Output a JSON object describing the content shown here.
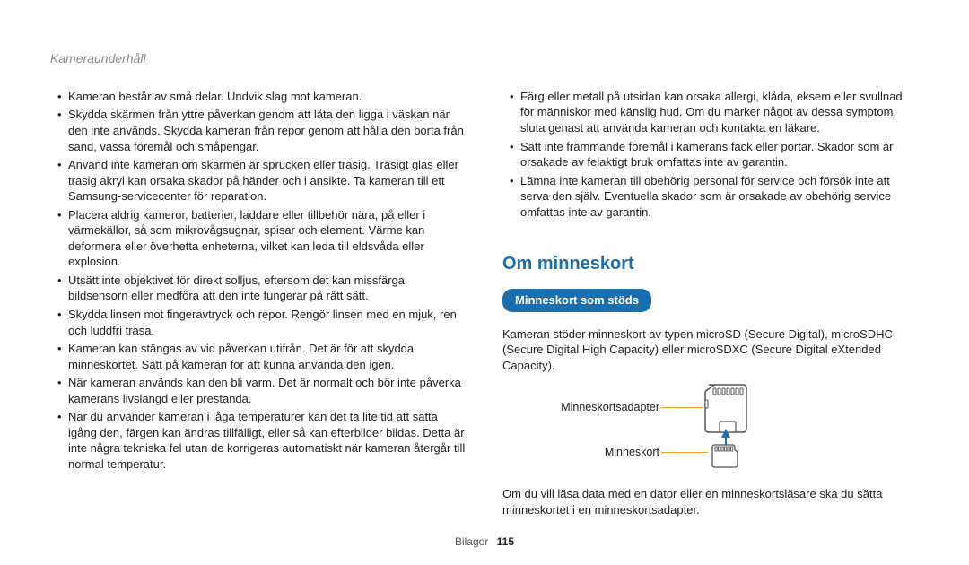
{
  "header": {
    "breadcrumb": "Kameraunderhåll"
  },
  "left": {
    "bullets": [
      "Kameran består av små delar. Undvik slag mot kameran.",
      "Skydda skärmen från yttre påverkan genom att låta den ligga i väskan när den inte används. Skydda kameran från repor genom att hålla den borta från sand, vassa föremål och småpengar.",
      "Använd inte kameran om skärmen är sprucken eller trasig. Trasigt glas eller trasig akryl kan orsaka skador på händer och i ansikte. Ta kameran till ett Samsung-servicecenter för reparation.",
      "Placera aldrig kameror, batterier, laddare eller tillbehör nära, på eller i värmekällor, så som mikrovågsugnar, spisar och element. Värme kan deformera eller överhetta enheterna, vilket kan leda till eldsvåda eller explosion.",
      "Utsätt inte objektivet för direkt solljus, eftersom det kan missfärga bildsensorn eller medföra att den inte fungerar på rätt sätt.",
      "Skydda linsen mot fingeravtryck och repor. Rengör linsen med en mjuk, ren och luddfri trasa.",
      "Kameran kan stängas av vid påverkan utifrån. Det är för att skydda minneskortet. Sätt på kameran för att kunna använda den igen.",
      "När kameran används kan den bli varm. Det är normalt och bör inte påverka kamerans livslängd eller prestanda.",
      "När du använder kameran i låga temperaturer kan det ta lite tid att sätta igång den, färgen kan ändras tillfälligt, eller så kan efterbilder bildas. Detta är inte några tekniska fel utan de korrigeras automatiskt när kameran återgår till normal temperatur."
    ]
  },
  "right": {
    "bullets": [
      "Färg eller metall på utsidan kan orsaka allergi, klåda, eksem eller svullnad för människor med känslig hud. Om du märker något av dessa symptom, sluta genast att använda kameran och kontakta en läkare.",
      "Sätt inte främmande föremål i kamerans fack eller portar. Skador som är orsakade av felaktigt bruk omfattas inte av garantin.",
      "Lämna inte kameran till obehörig personal för service och försök inte att serva den själv. Eventuella skador som är orsakade av obehörig service omfattas inte av garantin."
    ],
    "section_heading": "Om minneskort",
    "pill": "Minneskort som stöds",
    "intro": "Kameran stöder minneskort av typen microSD (Secure Digital), microSDHC (Secure Digital High Capacity) eller microSDXC (Secure Digital eXtended Capacity).",
    "label_adapter": "Minneskortsadapter",
    "label_card": "Minneskort",
    "outro": "Om du vill läsa data med en dator eller en minneskortsläsare ska du sätta minneskortet i en minneskortsadapter."
  },
  "footer": {
    "section": "Bilagor",
    "page": "115"
  }
}
